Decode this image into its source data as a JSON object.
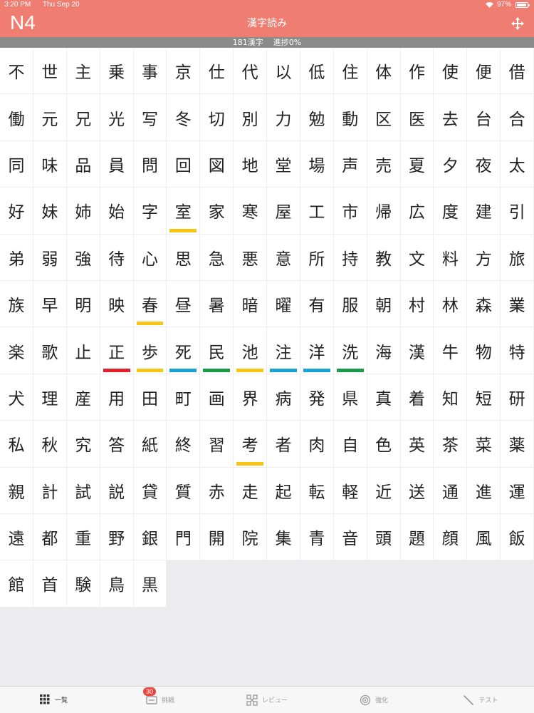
{
  "status": {
    "time": "3:20 PM",
    "date": "Thu Sep 20",
    "battery": "97%"
  },
  "header": {
    "level": "N4",
    "title": "漢字読み"
  },
  "progress": {
    "count": "181漢字",
    "label": "進捗0%"
  },
  "colors": {
    "yellow": "#f5c518",
    "red": "#e0202a",
    "blue": "#1ba2d4",
    "green": "#1a9a4a"
  },
  "kanji": [
    "不",
    "世",
    "主",
    "乗",
    "事",
    "京",
    "仕",
    "代",
    "以",
    "低",
    "住",
    "体",
    "作",
    "使",
    "便",
    "借",
    "働",
    "元",
    "兄",
    "光",
    "写",
    "冬",
    "切",
    "別",
    "力",
    "勉",
    "動",
    "区",
    "医",
    "去",
    "台",
    "合",
    "同",
    "味",
    "品",
    "員",
    "問",
    "回",
    "図",
    "地",
    "堂",
    "場",
    "声",
    "売",
    "夏",
    "夕",
    "夜",
    "太",
    "好",
    "妹",
    "姉",
    "始",
    "字",
    "室",
    "家",
    "寒",
    "屋",
    "工",
    "市",
    "帰",
    "広",
    "度",
    "建",
    "引",
    "弟",
    "弱",
    "強",
    "待",
    "心",
    "思",
    "急",
    "悪",
    "意",
    "所",
    "持",
    "教",
    "文",
    "料",
    "方",
    "旅",
    "族",
    "早",
    "明",
    "映",
    "春",
    "昼",
    "暑",
    "暗",
    "曜",
    "有",
    "服",
    "朝",
    "村",
    "林",
    "森",
    "業",
    "楽",
    "歌",
    "止",
    "正",
    "歩",
    "死",
    "民",
    "池",
    "注",
    "洋",
    "洗",
    "海",
    "漢",
    "牛",
    "物",
    "特",
    "犬",
    "理",
    "産",
    "用",
    "田",
    "町",
    "画",
    "界",
    "病",
    "発",
    "県",
    "真",
    "着",
    "知",
    "短",
    "研",
    "私",
    "秋",
    "究",
    "答",
    "紙",
    "終",
    "習",
    "考",
    "者",
    "肉",
    "自",
    "色",
    "英",
    "茶",
    "菜",
    "薬",
    "親",
    "計",
    "試",
    "説",
    "貸",
    "質",
    "赤",
    "走",
    "起",
    "転",
    "軽",
    "近",
    "送",
    "通",
    "進",
    "運",
    "遠",
    "都",
    "重",
    "野",
    "銀",
    "門",
    "開",
    "院",
    "集",
    "青",
    "音",
    "頭",
    "題",
    "顔",
    "風",
    "飯",
    "館",
    "首",
    "験",
    "鳥",
    "黒"
  ],
  "marks": {
    "室": "yellow",
    "春": "yellow",
    "正": "red",
    "歩": "yellow",
    "死": "blue",
    "民": "green",
    "池": "yellow",
    "注": "blue",
    "洋": "blue",
    "洗": "green",
    "考": "yellow"
  },
  "tabs": [
    {
      "label": "一覧",
      "icon": "grid-icon",
      "active": true
    },
    {
      "label": "挑戦",
      "icon": "challenge-icon",
      "badge": "30"
    },
    {
      "label": "レビュー",
      "icon": "review-icon"
    },
    {
      "label": "強化",
      "icon": "target-icon"
    },
    {
      "label": "テスト",
      "icon": "pencil-icon"
    }
  ]
}
